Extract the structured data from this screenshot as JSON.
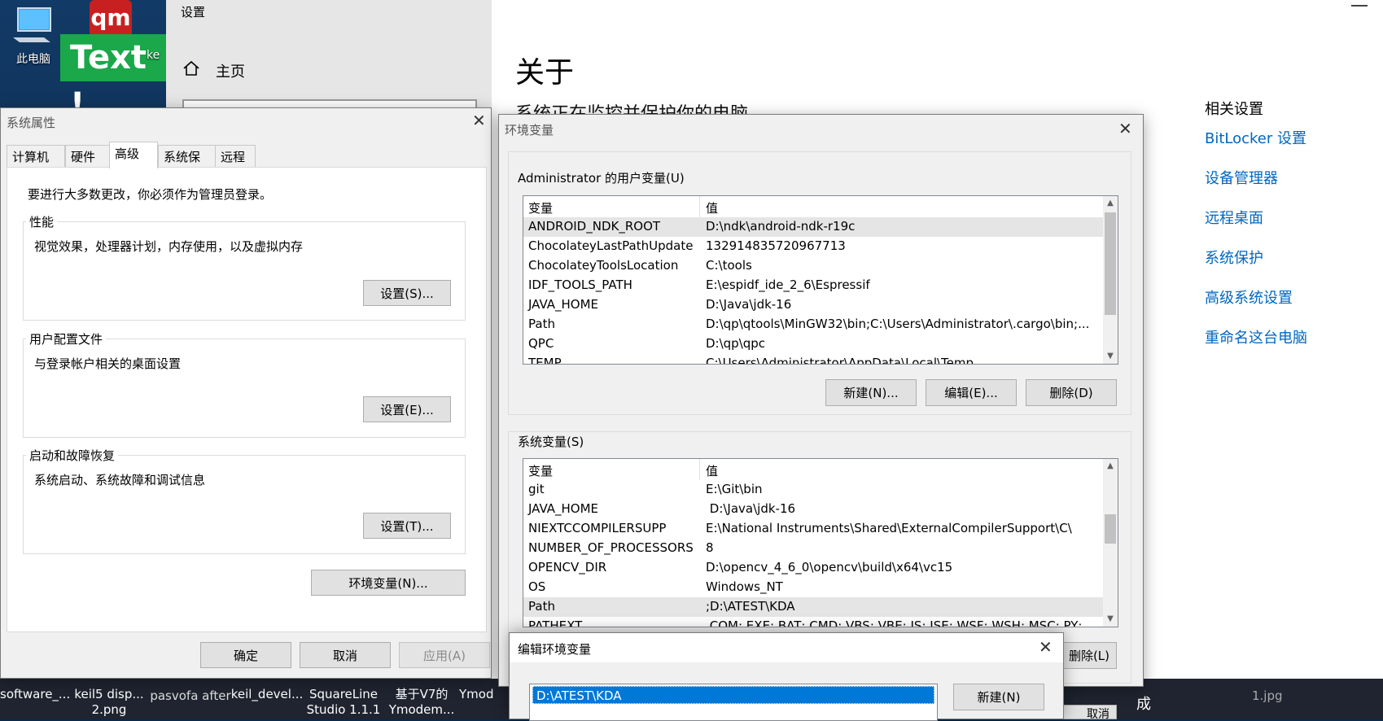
{
  "desktop": {
    "pc_label": "此电脑",
    "qm_text": "qm",
    "text_icon": "Text !",
    "partial_label": "ke"
  },
  "settings": {
    "window_title": "设置",
    "home_label": "主页",
    "about_title": "关于",
    "about_subtitle": "系统正在监控并保护你的电脑",
    "related_title": "相关设置",
    "related_links": [
      "BitLocker 设置",
      "设备管理器",
      "远程桌面",
      "系统保护",
      "高级系统设置",
      "重命名这台电脑"
    ]
  },
  "taskbar": {
    "items": [
      {
        "line1": "software_...",
        "line2": ""
      },
      {
        "line1": "keil5 disp...",
        "line2": "2.png"
      },
      {
        "line1": "pasvofa after",
        "line2": ""
      },
      {
        "line1": "keil_devel...",
        "line2": ""
      },
      {
        "line1": "SquareLine",
        "line2": "Studio 1.1.1"
      },
      {
        "line1": "基于V7的",
        "line2": "Ymodem..."
      },
      {
        "line1": "Ymod",
        "line2": ""
      }
    ],
    "right_text": "成",
    "right_file": "1.jpg"
  },
  "system_properties": {
    "title": "系统属性",
    "tabs": [
      "计算机名",
      "硬件",
      "高级",
      "系统保护",
      "远程"
    ],
    "active_tab": "高级",
    "admin_note": "要进行大多数更改，你必须作为管理员登录。",
    "groups": [
      {
        "label": "性能",
        "desc": "视觉效果，处理器计划，内存使用，以及虚拟内存",
        "button": "设置(S)..."
      },
      {
        "label": "用户配置文件",
        "desc": "与登录帐户相关的桌面设置",
        "button": "设置(E)..."
      },
      {
        "label": "启动和故障恢复",
        "desc": "系统启动、系统故障和调试信息",
        "button": "设置(T)..."
      }
    ],
    "env_button": "环境变量(N)...",
    "ok": "确定",
    "cancel": "取消",
    "apply": "应用(A)"
  },
  "env_vars": {
    "title": "环境变量",
    "user_section": "Administrator 的用户变量(U)",
    "col_var": "变量",
    "col_val": "值",
    "user_rows": [
      {
        "name": "ANDROID_NDK_ROOT",
        "value": "D:\\ndk\\android-ndk-r19c"
      },
      {
        "name": "ChocolateyLastPathUpdate",
        "value": "132914835720967713"
      },
      {
        "name": "ChocolateyToolsLocation",
        "value": "C:\\tools"
      },
      {
        "name": "IDF_TOOLS_PATH",
        "value": "E:\\espidf_ide_2_6\\Espressif"
      },
      {
        "name": "JAVA_HOME",
        "value": "D:\\Java\\jdk-16"
      },
      {
        "name": "Path",
        "value": "D:\\qp\\qtools\\MinGW32\\bin;C:\\Users\\Administrator\\.cargo\\bin;..."
      },
      {
        "name": "QPC",
        "value": "D:\\qp\\qpc"
      },
      {
        "name": "TEMP",
        "value": "C:\\Users\\Administrator\\AppData\\Local\\Temp"
      }
    ],
    "user_buttons": [
      "新建(N)...",
      "编辑(E)...",
      "删除(D)"
    ],
    "system_section": "系统变量(S)",
    "system_rows": [
      {
        "name": "git",
        "value": "E:\\Git\\bin"
      },
      {
        "name": "JAVA_HOME",
        "value": " D:\\Java\\jdk-16"
      },
      {
        "name": "NIEXTCCOMPILERSUPP",
        "value": "E:\\National Instruments\\Shared\\ExternalCompilerSupport\\C\\"
      },
      {
        "name": "NUMBER_OF_PROCESSORS",
        "value": "8"
      },
      {
        "name": "OPENCV_DIR",
        "value": "D:\\opencv_4_6_0\\opencv\\build\\x64\\vc15"
      },
      {
        "name": "OS",
        "value": "Windows_NT"
      },
      {
        "name": "Path",
        "value": ";D:\\ATEST\\KDA"
      },
      {
        "name": "PATHEXT",
        "value": ".COM;.EXE;.BAT;.CMD;.VBS;.VBE;.JS;.JSE;.WSF;.WSH;.MSC;.PY;.PYW"
      }
    ],
    "system_delete_button": "删除(L)",
    "partial_cancel": "取消"
  },
  "edit_env": {
    "title": "编辑环境变量",
    "entry": "D:\\ATEST\\KDA",
    "new_button": "新建(N)"
  }
}
